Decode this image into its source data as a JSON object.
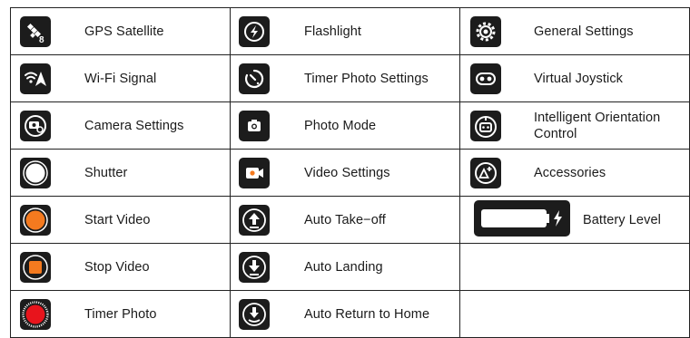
{
  "rows": [
    {
      "col1": {
        "label": "GPS Satellite",
        "icon": "satellite-icon"
      },
      "col2": {
        "label": "Flashlight",
        "icon": "flashlight-icon"
      },
      "col3": {
        "label": "General Settings",
        "icon": "gear-icon"
      }
    },
    {
      "col1": {
        "label": "Wi-Fi Signal",
        "icon": "wifi-signal-icon"
      },
      "col2": {
        "label": "Timer Photo Settings",
        "icon": "timer-icon"
      },
      "col3": {
        "label": "Virtual Joystick",
        "icon": "joystick-icon"
      }
    },
    {
      "col1": {
        "label": "Camera Settings",
        "icon": "camera-settings-icon"
      },
      "col2": {
        "label": "Photo Mode",
        "icon": "camera-icon"
      },
      "col3": {
        "label": "Intelligent Orientation Control",
        "icon": "robot-icon"
      }
    },
    {
      "col1": {
        "label": "Shutter",
        "icon": "shutter-icon"
      },
      "col2": {
        "label": "Video Settings",
        "icon": "video-camera-icon"
      },
      "col3": {
        "label": "Accessories",
        "icon": "accessories-icon"
      }
    },
    {
      "col1": {
        "label": "Start Video",
        "icon": "start-video-icon"
      },
      "col2": {
        "label": "Auto Take−off",
        "icon": "arrow-up-icon"
      },
      "col3": {
        "label": "Battery Level",
        "icon": "battery-icon"
      }
    },
    {
      "col1": {
        "label": "Stop Video",
        "icon": "stop-video-icon"
      },
      "col2": {
        "label": "Auto Landing",
        "icon": "arrow-down-icon"
      }
    },
    {
      "col1": {
        "label": "Timer Photo",
        "icon": "timer-photo-icon"
      },
      "col2": {
        "label": "Auto Return to Home",
        "icon": "return-home-icon"
      }
    }
  ],
  "colors": {
    "icon_bg": "#1c1c1c",
    "accent_orange": "#f47a1f",
    "accent_red": "#e8141c"
  }
}
